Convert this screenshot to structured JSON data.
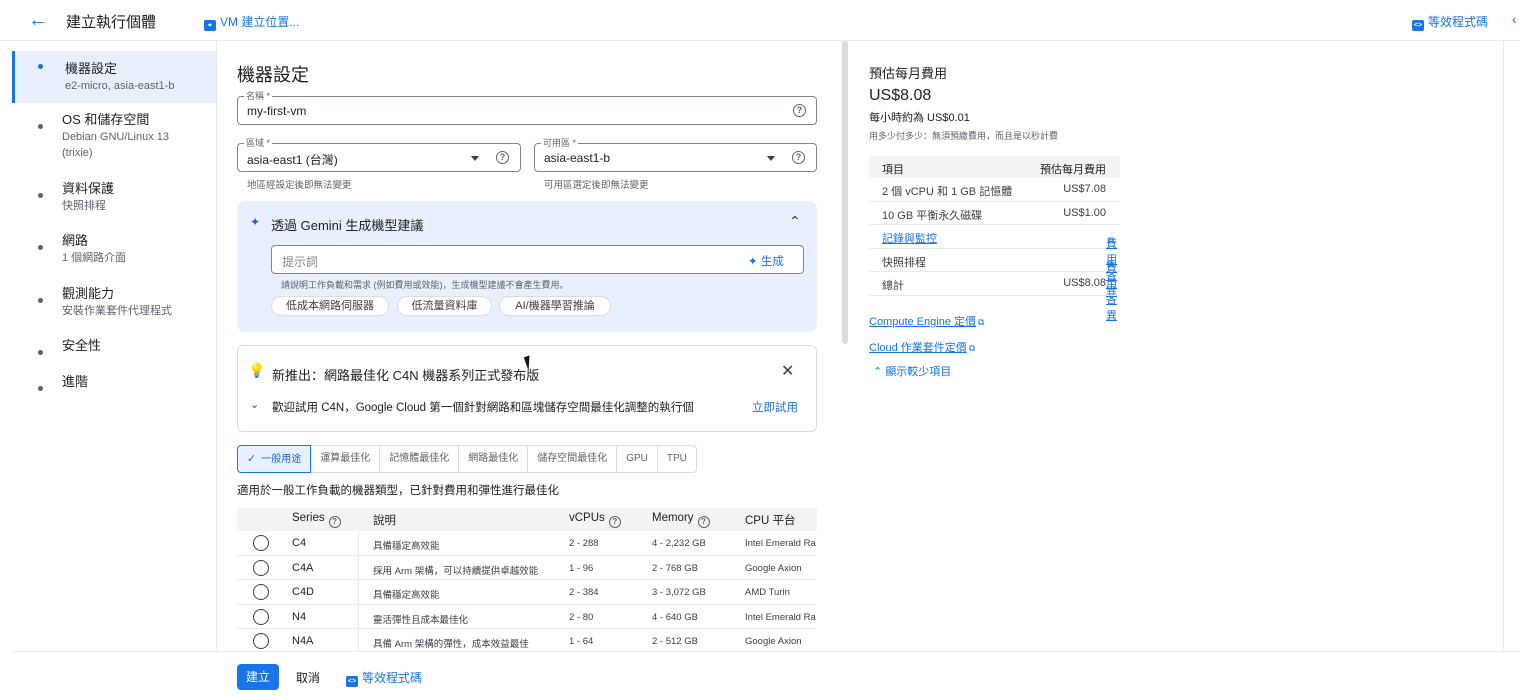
{
  "header": {
    "title": "建立執行個體",
    "vm_location": "VM 建立位置...",
    "equivalent_code": "等效程式碼"
  },
  "stepper": [
    {
      "title": "機器設定",
      "sub": "e2-micro, asia-east1-b",
      "sub2": ""
    },
    {
      "title": "OS 和儲存空間",
      "sub": "Debian GNU/Linux 13",
      "sub2": "(trixie)"
    },
    {
      "title": "資料保護",
      "sub": "快照排程",
      "sub2": ""
    },
    {
      "title": "網路",
      "sub": "1 個網路介面",
      "sub2": ""
    },
    {
      "title": "觀測能力",
      "sub": "安裝作業套件代理程式",
      "sub2": ""
    },
    {
      "title": "安全性",
      "sub": "",
      "sub2": ""
    },
    {
      "title": "進階",
      "sub": "",
      "sub2": ""
    }
  ],
  "form": {
    "section_title": "機器設定",
    "name": {
      "label": "名稱 *",
      "value": "my-first-vm"
    },
    "region": {
      "label": "區域 *",
      "value": "asia-east1 (台灣)",
      "hint": "地區經設定後即無法變更"
    },
    "zone": {
      "label": "可用區 *",
      "value": "asia-east1-b",
      "hint": "可用區選定後即無法變更"
    }
  },
  "gemini": {
    "title": "透過 Gemini 生成機型建議",
    "placeholder": "提示詞",
    "generate": "生成",
    "hint": "請說明工作負載和需求 (例如費用或效能)，生成機型建議不會產生費用。",
    "chips": [
      "低成本網路伺服器",
      "低流量資料庫",
      "AI/機器學習推論"
    ]
  },
  "news": {
    "title": "新推出：網路最佳化 C4N 機器系列正式發布版",
    "text": "歡迎試用 C4N，Google Cloud 第一個針對網路和區塊儲存空間最佳化調整的執行個",
    "action": "立即試用"
  },
  "tabs": {
    "items": [
      "一般用途",
      "運算最佳化",
      "記憶體最佳化",
      "網路最佳化",
      "儲存空間最佳化",
      "GPU",
      "TPU"
    ],
    "description": "適用於一般工作負載的機器類型，已針對費用和彈性進行最佳化"
  },
  "series_table": {
    "headers": {
      "series": "Series",
      "desc": "說明",
      "vcpus": "vCPUs",
      "memory": "Memory",
      "cpu": "CPU 平台"
    },
    "rows": [
      {
        "series": "C4",
        "desc": "具備穩定高效能",
        "vcpus": "2 - 288",
        "memory": "4 - 2,232 GB",
        "cpu": "Intel Emerald Ra"
      },
      {
        "series": "C4A",
        "desc": "採用 Arm 架構，可以持續提供卓越效能",
        "vcpus": "1 - 96",
        "memory": "2 - 768 GB",
        "cpu": "Google Axion"
      },
      {
        "series": "C4D",
        "desc": "具備穩定高效能",
        "vcpus": "2 - 384",
        "memory": "3 - 3,072 GB",
        "cpu": "AMD Turin"
      },
      {
        "series": "N4",
        "desc": "靈活彈性且成本最佳化",
        "vcpus": "2 - 80",
        "memory": "4 - 640 GB",
        "cpu": "Intel Emerald Ra"
      },
      {
        "series": "N4A",
        "desc": "具備 Arm 架構的彈性，成本效益最佳",
        "vcpus": "1 - 64",
        "memory": "2 - 512 GB",
        "cpu": "Google Axion"
      }
    ]
  },
  "cost": {
    "title": "預估每月費用",
    "monthly": "US$8.08",
    "hourly": "每小時約為 US$0.01",
    "note": "用多少付多少：無須預繳費用，而且是以秒計費",
    "table_headers": {
      "item": "項目",
      "value": "預估每月費用"
    },
    "rows": [
      {
        "item": "2 個 vCPU 和 1 GB 記憶體",
        "value": "US$7.08"
      },
      {
        "item": "10 GB 平衡永久磁碟",
        "value": "US$1.00"
      },
      {
        "item": "記錄與監控",
        "value": "費用各異"
      },
      {
        "item": "快照排程",
        "value": "費用各異"
      },
      {
        "item": "總計",
        "value": "US$8.08"
      }
    ],
    "links": [
      "Compute Engine 定價",
      "Cloud 作業套件定價"
    ],
    "show_less": "顯示較少項目"
  },
  "footer": {
    "create": "建立",
    "cancel": "取消",
    "equivalent_code": "等效程式碼"
  },
  "colors": {
    "accent": "#1a73e8",
    "accent_light": "#e8f0fe"
  }
}
